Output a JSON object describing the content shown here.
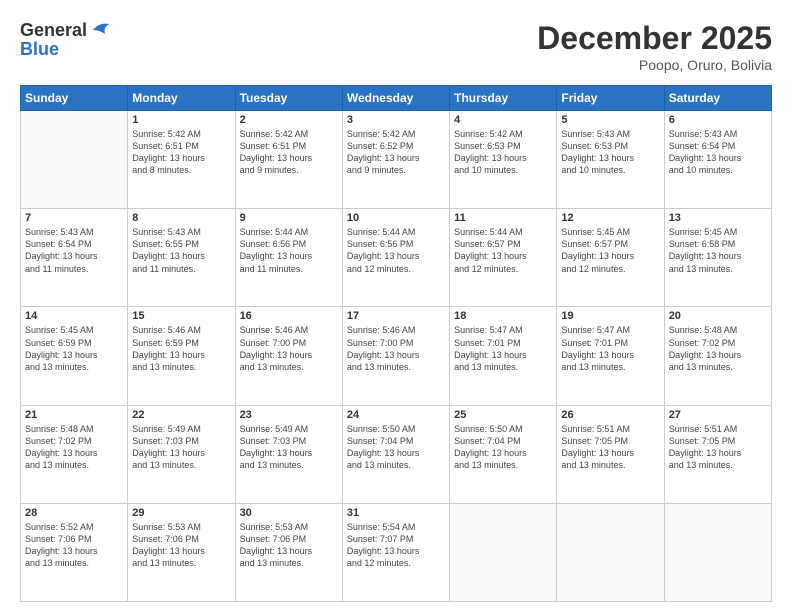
{
  "logo": {
    "line1": "General",
    "line2": "Blue"
  },
  "header": {
    "month": "December 2025",
    "location": "Poopo, Oruro, Bolivia"
  },
  "weekdays": [
    "Sunday",
    "Monday",
    "Tuesday",
    "Wednesday",
    "Thursday",
    "Friday",
    "Saturday"
  ],
  "weeks": [
    [
      {
        "day": "",
        "info": ""
      },
      {
        "day": "1",
        "info": "Sunrise: 5:42 AM\nSunset: 6:51 PM\nDaylight: 13 hours\nand 8 minutes."
      },
      {
        "day": "2",
        "info": "Sunrise: 5:42 AM\nSunset: 6:51 PM\nDaylight: 13 hours\nand 9 minutes."
      },
      {
        "day": "3",
        "info": "Sunrise: 5:42 AM\nSunset: 6:52 PM\nDaylight: 13 hours\nand 9 minutes."
      },
      {
        "day": "4",
        "info": "Sunrise: 5:42 AM\nSunset: 6:53 PM\nDaylight: 13 hours\nand 10 minutes."
      },
      {
        "day": "5",
        "info": "Sunrise: 5:43 AM\nSunset: 6:53 PM\nDaylight: 13 hours\nand 10 minutes."
      },
      {
        "day": "6",
        "info": "Sunrise: 5:43 AM\nSunset: 6:54 PM\nDaylight: 13 hours\nand 10 minutes."
      }
    ],
    [
      {
        "day": "7",
        "info": "Sunrise: 5:43 AM\nSunset: 6:54 PM\nDaylight: 13 hours\nand 11 minutes."
      },
      {
        "day": "8",
        "info": "Sunrise: 5:43 AM\nSunset: 6:55 PM\nDaylight: 13 hours\nand 11 minutes."
      },
      {
        "day": "9",
        "info": "Sunrise: 5:44 AM\nSunset: 6:56 PM\nDaylight: 13 hours\nand 11 minutes."
      },
      {
        "day": "10",
        "info": "Sunrise: 5:44 AM\nSunset: 6:56 PM\nDaylight: 13 hours\nand 12 minutes."
      },
      {
        "day": "11",
        "info": "Sunrise: 5:44 AM\nSunset: 6:57 PM\nDaylight: 13 hours\nand 12 minutes."
      },
      {
        "day": "12",
        "info": "Sunrise: 5:45 AM\nSunset: 6:57 PM\nDaylight: 13 hours\nand 12 minutes."
      },
      {
        "day": "13",
        "info": "Sunrise: 5:45 AM\nSunset: 6:58 PM\nDaylight: 13 hours\nand 13 minutes."
      }
    ],
    [
      {
        "day": "14",
        "info": "Sunrise: 5:45 AM\nSunset: 6:59 PM\nDaylight: 13 hours\nand 13 minutes."
      },
      {
        "day": "15",
        "info": "Sunrise: 5:46 AM\nSunset: 6:59 PM\nDaylight: 13 hours\nand 13 minutes."
      },
      {
        "day": "16",
        "info": "Sunrise: 5:46 AM\nSunset: 7:00 PM\nDaylight: 13 hours\nand 13 minutes."
      },
      {
        "day": "17",
        "info": "Sunrise: 5:46 AM\nSunset: 7:00 PM\nDaylight: 13 hours\nand 13 minutes."
      },
      {
        "day": "18",
        "info": "Sunrise: 5:47 AM\nSunset: 7:01 PM\nDaylight: 13 hours\nand 13 minutes."
      },
      {
        "day": "19",
        "info": "Sunrise: 5:47 AM\nSunset: 7:01 PM\nDaylight: 13 hours\nand 13 minutes."
      },
      {
        "day": "20",
        "info": "Sunrise: 5:48 AM\nSunset: 7:02 PM\nDaylight: 13 hours\nand 13 minutes."
      }
    ],
    [
      {
        "day": "21",
        "info": "Sunrise: 5:48 AM\nSunset: 7:02 PM\nDaylight: 13 hours\nand 13 minutes."
      },
      {
        "day": "22",
        "info": "Sunrise: 5:49 AM\nSunset: 7:03 PM\nDaylight: 13 hours\nand 13 minutes."
      },
      {
        "day": "23",
        "info": "Sunrise: 5:49 AM\nSunset: 7:03 PM\nDaylight: 13 hours\nand 13 minutes."
      },
      {
        "day": "24",
        "info": "Sunrise: 5:50 AM\nSunset: 7:04 PM\nDaylight: 13 hours\nand 13 minutes."
      },
      {
        "day": "25",
        "info": "Sunrise: 5:50 AM\nSunset: 7:04 PM\nDaylight: 13 hours\nand 13 minutes."
      },
      {
        "day": "26",
        "info": "Sunrise: 5:51 AM\nSunset: 7:05 PM\nDaylight: 13 hours\nand 13 minutes."
      },
      {
        "day": "27",
        "info": "Sunrise: 5:51 AM\nSunset: 7:05 PM\nDaylight: 13 hours\nand 13 minutes."
      }
    ],
    [
      {
        "day": "28",
        "info": "Sunrise: 5:52 AM\nSunset: 7:06 PM\nDaylight: 13 hours\nand 13 minutes."
      },
      {
        "day": "29",
        "info": "Sunrise: 5:53 AM\nSunset: 7:06 PM\nDaylight: 13 hours\nand 13 minutes."
      },
      {
        "day": "30",
        "info": "Sunrise: 5:53 AM\nSunset: 7:06 PM\nDaylight: 13 hours\nand 13 minutes."
      },
      {
        "day": "31",
        "info": "Sunrise: 5:54 AM\nSunset: 7:07 PM\nDaylight: 13 hours\nand 12 minutes."
      },
      {
        "day": "",
        "info": ""
      },
      {
        "day": "",
        "info": ""
      },
      {
        "day": "",
        "info": ""
      }
    ]
  ]
}
